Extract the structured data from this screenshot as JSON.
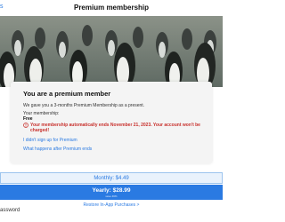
{
  "navbar": {
    "back_label": "s",
    "title": "Premium membership"
  },
  "card": {
    "title": "You are a premium member",
    "subtitle": "We gave you a 3-months Premium Membership as a present.",
    "membership_label": "Your membership:",
    "membership_value": "Free",
    "warning": "Your membership automatically ends November 21, 2023. Your account won't be charged!",
    "link_no_signup": "I didn't sign up for Premium",
    "link_after": "What happens after Premium ends"
  },
  "plans": {
    "monthly_label": "Monthly: $4.49",
    "yearly_label": "Yearly: $28.99",
    "yearly_sub": "save 46%"
  },
  "restore_link": "Restore In-App Purchases >",
  "bottom_label": "assword",
  "colors": {
    "accent": "#2a7ae2",
    "warning": "#c8302c"
  }
}
